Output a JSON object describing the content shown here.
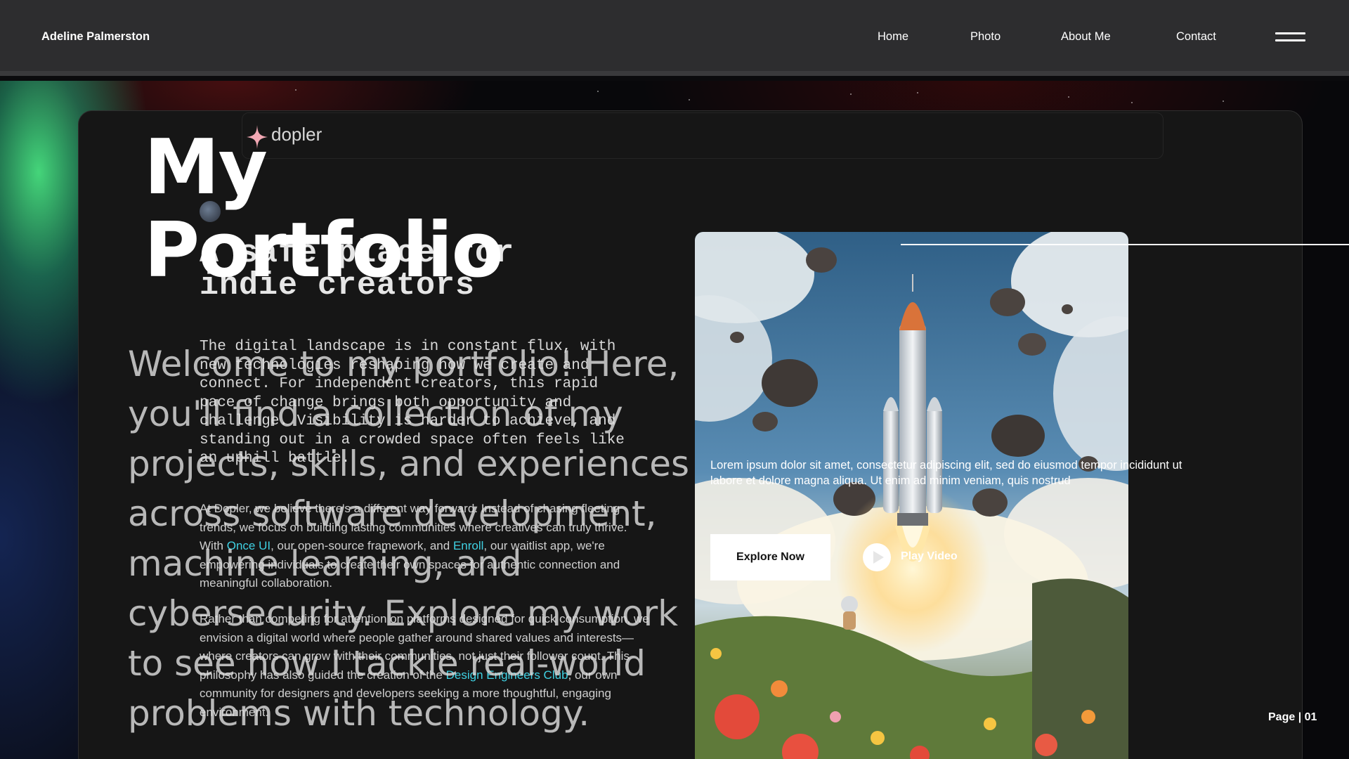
{
  "navbar": {
    "brand": "Adeline Palmerston",
    "links": [
      "Home",
      "Photo",
      "About Me",
      "Contact"
    ],
    "menu_icon": "hamburger-icon"
  },
  "background_site": {
    "logo": "dopler",
    "logo_icon": "sparkle-icon",
    "heading": "A safe place for indie creators",
    "paragraph_mono": "The digital landscape is in constant flux, with new technologies reshaping how we create and connect. For independent creators, this rapid pace of change brings both opportunity and challenge. Visibility is harder to achieve, and standing out in a crowded space often feels like an uphill battle.",
    "paragraph_1": {
      "pre": "At Dopler, we believe there's a different way forward. Instead of chasing fleeting trends, we focus on building lasting communities where creatives can truly thrive. With ",
      "link_1": "Once UI",
      "mid": ", our open-source framework, and ",
      "link_2": "Enroll",
      "post": ", our waitlist app, we're empowering individuals to create their own spaces for authentic connection and meaningful collaboration."
    },
    "paragraph_2": {
      "pre": "Rather than competing for attention on platforms designed for quick consumption, we envision a digital world where people gather around shared values and interests—where creators can grow with their communities, not just their follower count. This philosophy has also guided the creation of the ",
      "link": "Design Engineers Club",
      "post": ", our own community for designers and developers seeking a more thoughtful, engaging environment."
    }
  },
  "hero": {
    "title_line1": "My",
    "title_line2": "Portfolio",
    "description": "Welcome to my portfolio! Here, you'll find a collection of my projects, skills, and experiences across software development, machine learning, and cybersecurity. Explore my work to see how I tackle real-world problems with technology."
  },
  "feature": {
    "lorem": "Lorem ipsum dolor sit amet, consectetur adipiscing elit, sed do eiusmod tempor incididunt ut labore et dolore magna aliqua. Ut enim ad minim veniam, quis nostrud",
    "explore_button": "Explore Now",
    "play_label": "Play Video",
    "play_icon": "play-icon",
    "image": "rocket-launch-illustration"
  },
  "page_indicator": "Page | 01"
}
